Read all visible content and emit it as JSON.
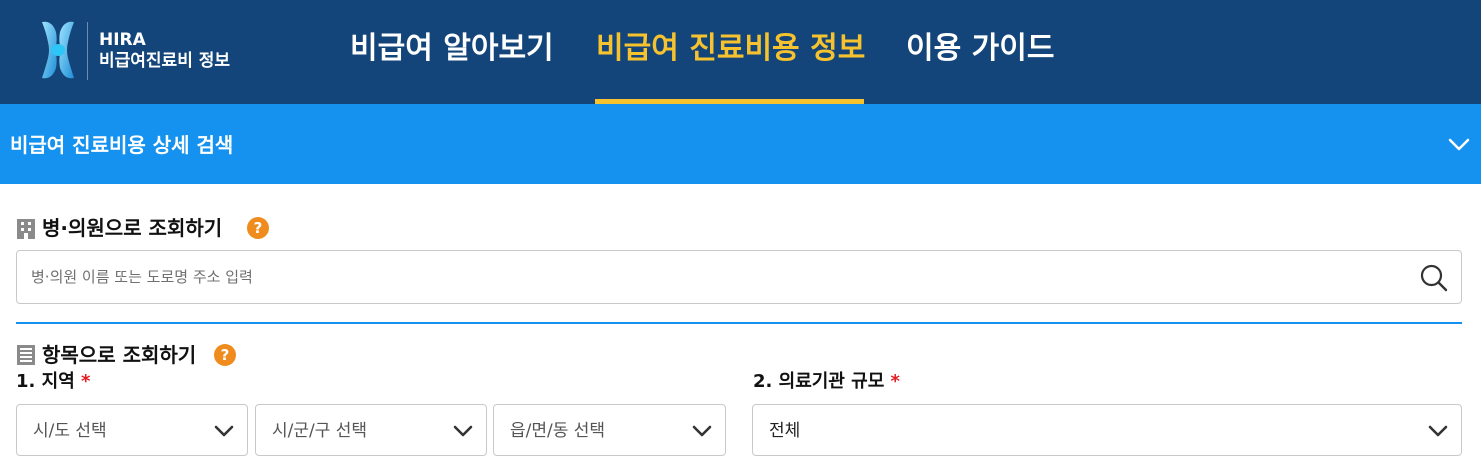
{
  "header": {
    "brand_name": "HIRA",
    "brand_sub": "비급여진료비 정보",
    "nav": [
      {
        "label": "비급여 알아보기",
        "active": false
      },
      {
        "label": "비급여 진료비용 정보",
        "active": true
      },
      {
        "label": "이용 가이드",
        "active": false
      }
    ]
  },
  "colors": {
    "header_bg": "#13457a",
    "active_nav": "#f6c22e",
    "bar_blue": "#1592ef",
    "help_orange": "#f08c1e",
    "required_red": "#e31b23"
  },
  "detail_search": {
    "title": "비급여 진료비용 상세 검색",
    "toggle_icon": "chevron-down-icon"
  },
  "hospital_search": {
    "title": "병·의원으로 조회하기",
    "section_icon": "building-icon",
    "help_icon": "question-icon",
    "help_symbol": "?",
    "placeholder": "병·의원 이름 또는 도로명 주소 입력",
    "value": "",
    "search_icon": "search-icon"
  },
  "item_search": {
    "title": "항목으로 조회하기",
    "section_icon": "list-icon",
    "help_symbol": "?",
    "region": {
      "label": "1. 지역",
      "required_mark": "*",
      "selects": [
        {
          "value": "시/도 선택"
        },
        {
          "value": "시/군/구 선택"
        },
        {
          "value": "읍/면/동 선택"
        }
      ]
    },
    "scale": {
      "label": "2. 의료기관 규모",
      "required_mark": "*",
      "value": "전체"
    }
  }
}
